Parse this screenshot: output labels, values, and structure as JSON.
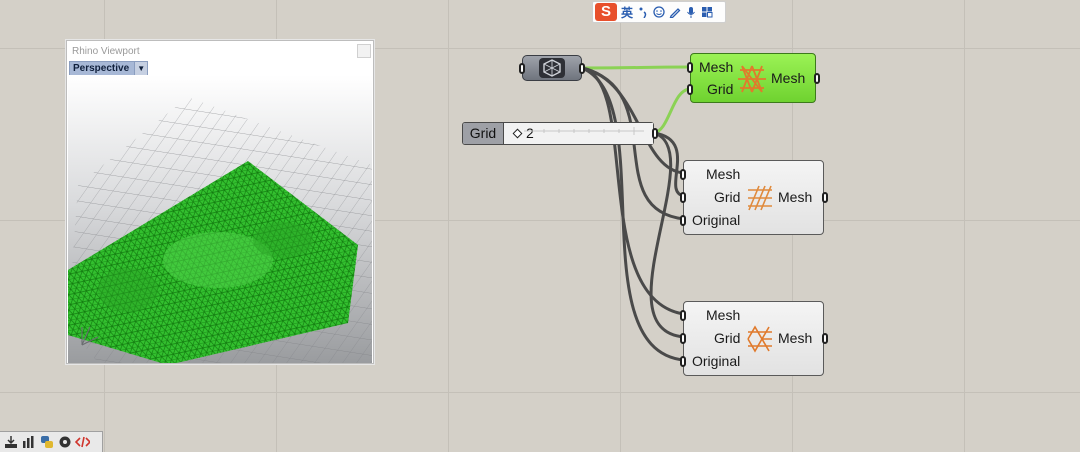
{
  "ime": {
    "logo": "S",
    "lang_label": "英",
    "icons": [
      "punctuation-icon",
      "emoji-icon",
      "pen-icon",
      "mic-icon",
      "toolbox-icon"
    ]
  },
  "viewport": {
    "window_title": "Rhino Viewport",
    "view_name": "Perspective"
  },
  "slider": {
    "name": "Grid",
    "value": "2"
  },
  "components": {
    "top": {
      "in1": "Mesh",
      "in2": "Grid",
      "out": "Mesh",
      "state": "selected"
    },
    "middle": {
      "in1": "Mesh",
      "in2": "Grid",
      "in3": "Original",
      "out": "Mesh"
    },
    "bottom": {
      "in1": "Mesh",
      "in2": "Grid",
      "in3": "Original",
      "out": "Mesh"
    }
  },
  "taskbar": {
    "icons": [
      "download-icon",
      "chart-icon",
      "python-icon",
      "settings-icon",
      "code-icon"
    ]
  },
  "colors": {
    "canvas": "#d4d0c8",
    "selected_component": "#7fdc3c",
    "selected_wire": "#8bd255",
    "wire": "#4a4a4a",
    "mesh_icon": "#e07a2c",
    "mesh_surface": "#2fbf2c"
  }
}
